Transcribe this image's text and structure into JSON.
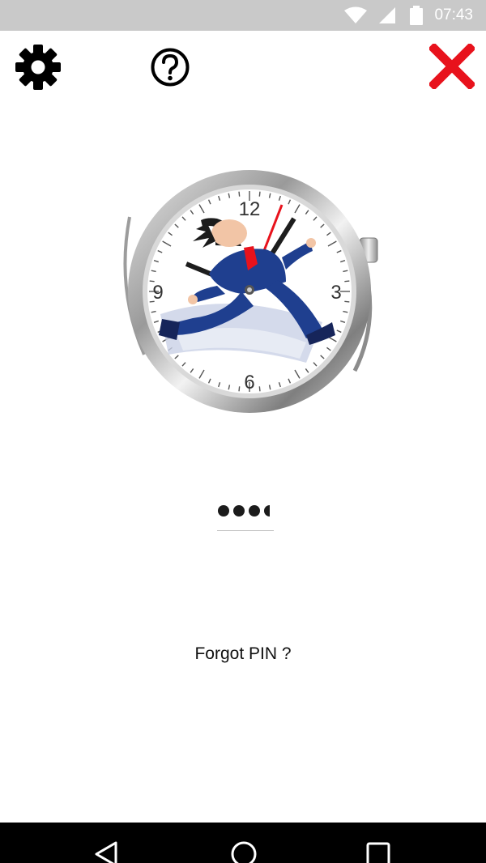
{
  "status_bar": {
    "time": "07:43",
    "icons": [
      "wifi-icon",
      "cell-signal-icon",
      "battery-icon"
    ]
  },
  "toolbar": {
    "settings_icon": "gear-icon",
    "help_icon": "question-circle-icon",
    "close_icon": "close-x-icon",
    "close_color": "#e8121c"
  },
  "watch": {
    "dial_numbers": [
      "12",
      "3",
      "6",
      "9"
    ]
  },
  "pin": {
    "entered_digits": 4,
    "masked_display": "●●●●"
  },
  "forgot_pin_label": "Forgot PIN ?",
  "nav_bar": {
    "buttons": [
      "back-icon",
      "home-icon",
      "recents-icon"
    ]
  }
}
